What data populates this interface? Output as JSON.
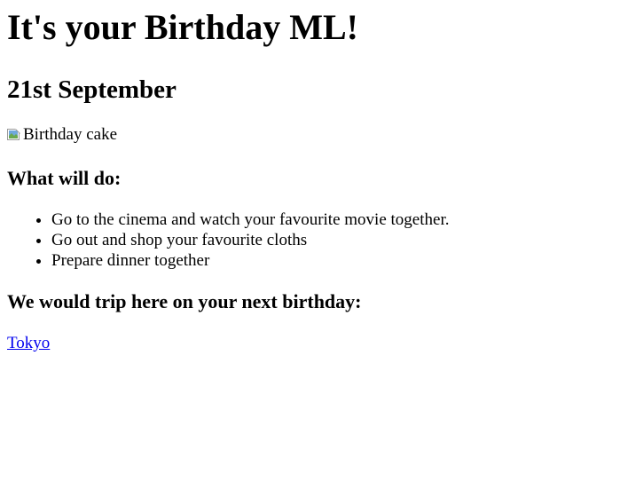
{
  "title": "It's your Birthday ML!",
  "date": "21st September",
  "image": {
    "alt": "Birthday cake",
    "icon": "broken-image-icon"
  },
  "plans": {
    "heading": "What will do:",
    "items": [
      "Go to the cinema and watch your favourite movie together.",
      "Go out and shop your favourite cloths",
      "Prepare dinner together"
    ]
  },
  "trip": {
    "heading": "We would trip here on your next birthday:",
    "link_label": "Tokyo"
  },
  "colors": {
    "link": "#0000ee",
    "text": "#000000",
    "background": "#ffffff"
  }
}
